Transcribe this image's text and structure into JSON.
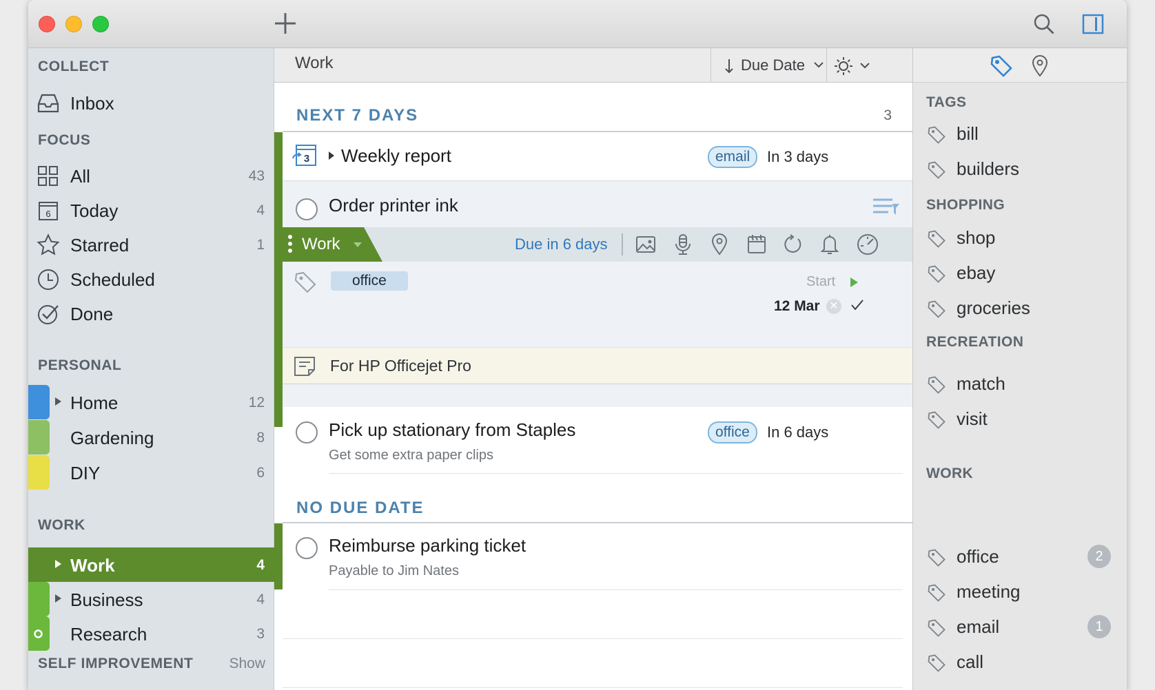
{
  "sidebar": {
    "collect": "COLLECT",
    "inbox": "Inbox",
    "focus": "FOCUS",
    "items_focus": [
      {
        "label": "All",
        "count": "43"
      },
      {
        "label": "Today",
        "count": "4",
        "icon_text": "6"
      },
      {
        "label": "Starred",
        "count": "1"
      },
      {
        "label": "Scheduled"
      },
      {
        "label": "Done"
      }
    ],
    "personal": "PERSONAL",
    "items_personal": [
      {
        "label": "Home",
        "count": "12",
        "color": "#3e8fdc"
      },
      {
        "label": "Gardening",
        "count": "8",
        "color": "#8dbf63"
      },
      {
        "label": "DIY",
        "count": "6",
        "color": "#e8de45"
      }
    ],
    "work": "WORK",
    "items_work": [
      {
        "label": "Work",
        "count": "4",
        "color": "#5c8c2c"
      },
      {
        "label": "Business",
        "count": "4",
        "color": "#6bb83d"
      },
      {
        "label": "Research",
        "count": "3",
        "color": "#6bb83d"
      }
    ],
    "self_improvement": "SELF IMPROVEMENT",
    "show": "Show"
  },
  "header": {
    "title": "Work",
    "sort_label": "Due Date"
  },
  "groups": {
    "next7": {
      "label": "NEXT 7 DAYS",
      "count": "3"
    },
    "nodue": {
      "label": "NO DUE DATE"
    }
  },
  "tasks": {
    "weekly": {
      "title": "Weekly report",
      "tag": "email",
      "due": "In 3 days",
      "icon_text": "3"
    },
    "printer": {
      "title": "Order printer ink",
      "project": "Work",
      "due_text": "Due in 6 days",
      "tag": "office",
      "start_label": "Start",
      "date": "12 Mar",
      "note": "For HP Officejet Pro"
    },
    "stationary": {
      "title": "Pick up stationary from Staples",
      "tag": "office",
      "due": "In 6 days",
      "note": "Get some extra paper clips"
    },
    "parking": {
      "title": "Reimburse parking ticket",
      "note": "Payable to Jim Nates"
    }
  },
  "tags_panel": {
    "tags_header": "TAGS",
    "tags": [
      "bill",
      "builders"
    ],
    "shopping_header": "SHOPPING",
    "shopping": [
      "shop",
      "ebay",
      "groceries"
    ],
    "recreation_header": "RECREATION",
    "recreation": [
      "match",
      "visit"
    ],
    "work_header": "WORK",
    "work": [
      {
        "label": "office",
        "badge": "2"
      },
      {
        "label": "meeting"
      },
      {
        "label": "email",
        "badge": "1"
      },
      {
        "label": "call"
      }
    ]
  },
  "colors": {
    "accent_green": "#5c8c2c",
    "tag_blue": "#2d6696",
    "header_blue": "#4b82ad"
  }
}
